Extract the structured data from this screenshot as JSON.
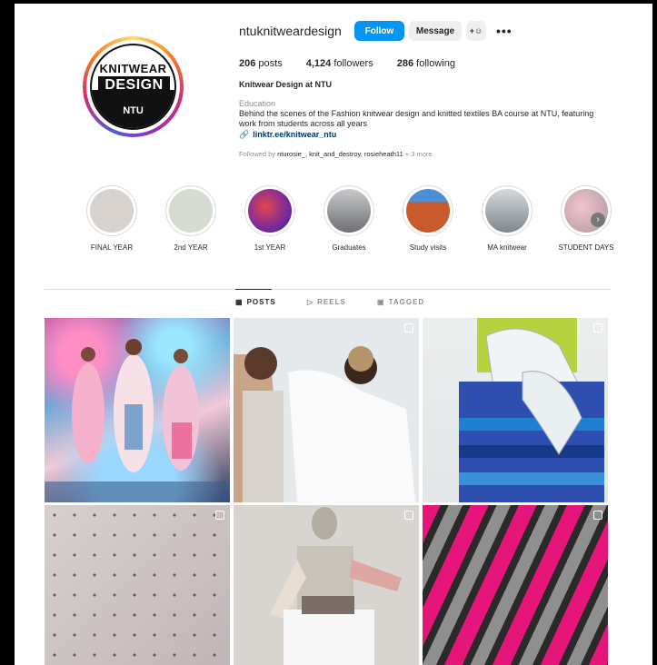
{
  "profile": {
    "username": "ntuknitweardesign",
    "follow_label": "Follow",
    "message_label": "Message",
    "add_user_glyph": "+☺",
    "more_glyph": "•••",
    "posts_count": "206",
    "posts_label": "posts",
    "followers_count": "4,124",
    "followers_label": "followers",
    "following_count": "286",
    "following_label": "following",
    "full_name": "Knitwear Design at NTU",
    "category": "Education",
    "bio": "Behind the scenes of the Fashion knitwear design and knitted textiles BA course at NTU, featuring work from students across all years",
    "link": "linktr.ee/knitwear_ntu",
    "followed_by_prefix": "Followed by ",
    "followed_by_names": "nturosie_, knit_and_destroy, rosieheath11",
    "followed_by_suffix": " + 3 more",
    "avatar_logo_line1": "KNITWEAR",
    "avatar_logo_line2": "DESIGN",
    "avatar_logo_line3": "NTU"
  },
  "highlights": [
    {
      "label": "FINAL YEAR",
      "color": "#d9d3cf"
    },
    {
      "label": "2nd YEAR",
      "color": "#d6dbd2"
    },
    {
      "label": "1st YEAR",
      "color": "#9b2a88"
    },
    {
      "label": "Graduates",
      "color": "#8d8f92"
    },
    {
      "label": "Study visits",
      "color": "#c95a2b"
    },
    {
      "label": "MA knitwear",
      "color": "#b5bcc2"
    },
    {
      "label": "STUDENT DAYS",
      "color": "#d8a7b6"
    }
  ],
  "tabs": {
    "posts": "POSTS",
    "reels": "REELS",
    "tagged": "TAGGED"
  },
  "colors": {
    "accent": "#0095f6",
    "link": "#00376b"
  }
}
